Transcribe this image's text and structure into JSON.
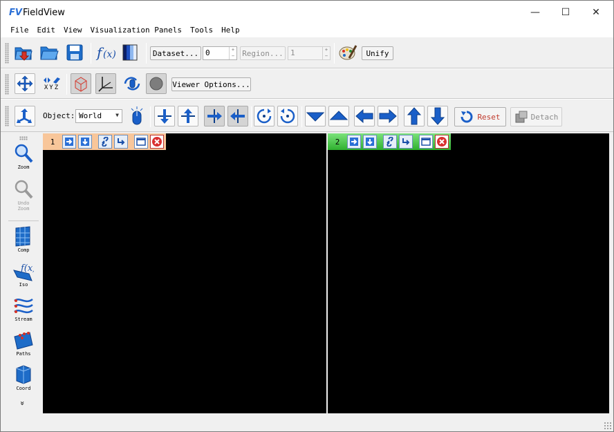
{
  "window": {
    "title": "FieldView",
    "logo": "FV"
  },
  "window_controls": {
    "minimize": "—",
    "maximize": "☐",
    "close": "✕"
  },
  "menu": [
    "File",
    "Edit",
    "View",
    "Visualization Panels",
    "Tools",
    "Help"
  ],
  "toolbar1": {
    "dataset_label": "Dataset...",
    "dataset_value": "0",
    "region_label": "Region...",
    "region_value": "1",
    "unify_label": "Unify"
  },
  "toolbar2": {
    "xyz_label": "XYZ",
    "viewer_options_label": "Viewer Options..."
  },
  "toolbar3": {
    "object_label": "Object:",
    "object_value": "World",
    "reset_label": "Reset",
    "detach_label": "Detach"
  },
  "sidebar": {
    "tools": [
      {
        "name": "zoom",
        "label": "Zoom"
      },
      {
        "name": "undo-zoom",
        "label": "Undo\nZoom"
      },
      {
        "name": "comp",
        "label": "Comp"
      },
      {
        "name": "iso",
        "label": "Iso"
      },
      {
        "name": "stream",
        "label": "Stream"
      },
      {
        "name": "paths",
        "label": "Paths"
      },
      {
        "name": "coord",
        "label": "Coord"
      }
    ],
    "more": "»"
  },
  "viewports": [
    {
      "number": "1",
      "color": "#f8c69a"
    },
    {
      "number": "2",
      "color": "#47c447"
    }
  ],
  "colors": {
    "accent_blue": "#1a5fc8",
    "reset_red": "#c0392b",
    "close_red": "#d93030"
  }
}
